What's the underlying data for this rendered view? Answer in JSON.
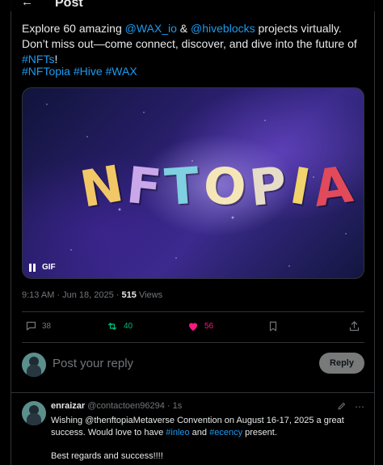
{
  "header": {
    "back_icon": "arrow-left-icon",
    "title": "Post"
  },
  "post": {
    "text_intro": "Explore 60 amazing ",
    "mention1": "@WAX_io",
    "amp": " & ",
    "mention2": "@hiveblocks",
    "text_mid": " projects virtually. Don’t miss out—come connect, discover, and dive into the future of ",
    "tag_nfts": "#NFTs",
    "text_end": "!",
    "hashtags": [
      "#NFTopia",
      "#Hive",
      "#WAX"
    ],
    "media": {
      "logo_letters": [
        "N",
        "F",
        "T",
        "O",
        "P",
        "I",
        "A"
      ],
      "logo_colors": [
        "#f2c766",
        "#c9a7e8",
        "#7fd0e0",
        "#f5e6b8",
        "#e7dcc7",
        "#f0d36b",
        "#e04a5a"
      ],
      "gif_label": "GIF",
      "pause_icon": "pause-icon"
    },
    "time": "9:13 AM · Jun 18, 2025 · ",
    "views_count": "515",
    "views_label": " Views",
    "actions": {
      "replies": "38",
      "reposts": "40",
      "likes": "56",
      "reply_icon": "comment-icon",
      "repost_icon": "repost-icon",
      "like_icon": "heart-icon",
      "bookmark_icon": "bookmark-icon",
      "share_icon": "share-icon",
      "repost_color": "#00ba7c",
      "like_color": "#f91880"
    }
  },
  "reply_composer": {
    "placeholder": "Post your reply",
    "button": "Reply"
  },
  "comment": {
    "name": "enraizar",
    "handle": "@contactoen96294",
    "sep": " · ",
    "time": "1s",
    "line1": "Wishing @thenftopiaMetaverse Convention on August 16-17, 2025 a great",
    "line2_a": "success. Would love to have ",
    "tag1": "#inleo",
    "line2_b": " and ",
    "tag2": "#ecency",
    "line2_c": " present.",
    "closing": "Best regards and success!!!!",
    "edit_icon": "edit-icon",
    "more_icon": "more-icon"
  }
}
